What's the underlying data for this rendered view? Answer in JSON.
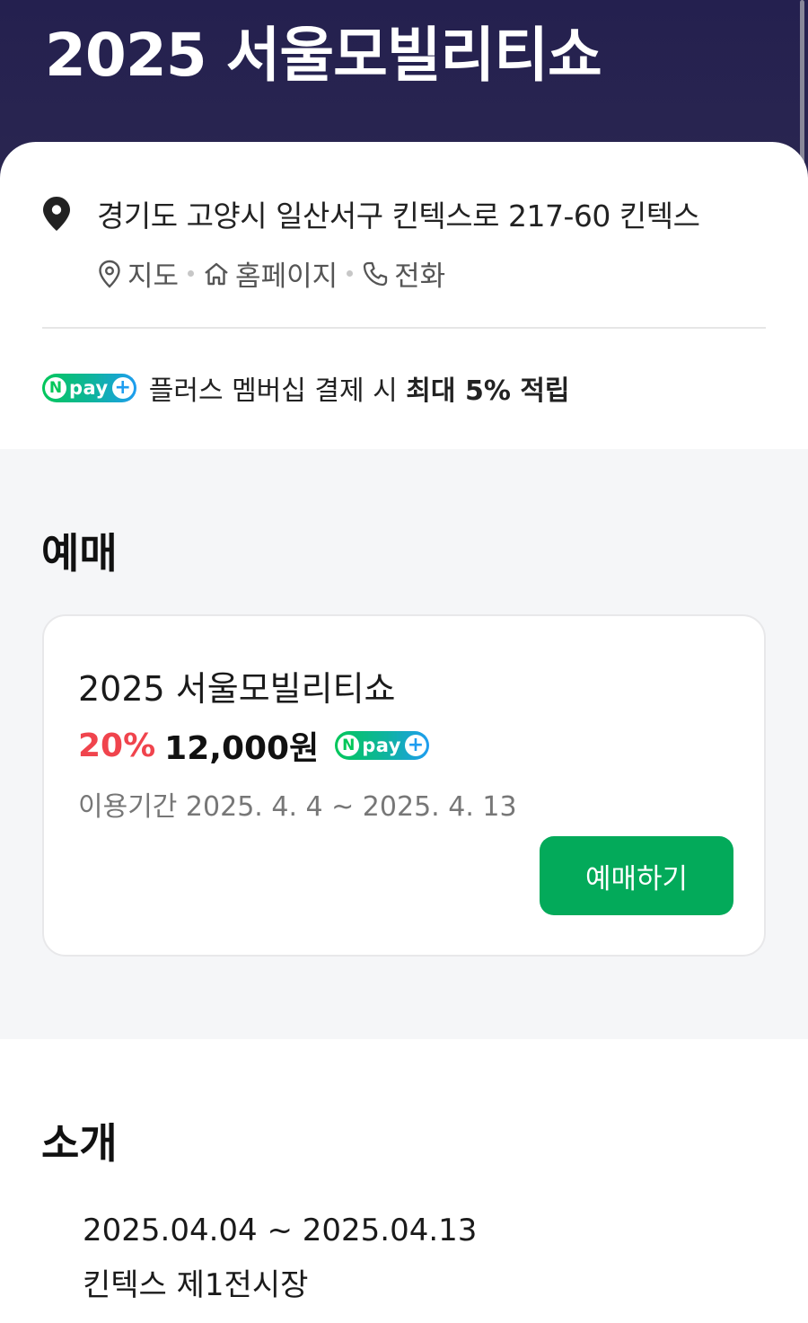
{
  "header": {
    "title": "2025 서울모빌리티쇼"
  },
  "info": {
    "address": "경기도 고양시 일산서구 킨텍스로 217-60 킨텍스",
    "links": [
      {
        "label": "지도",
        "icon": "map-pin-outline-icon"
      },
      {
        "label": "홈페이지",
        "icon": "home-icon"
      },
      {
        "label": "전화",
        "icon": "phone-icon"
      }
    ],
    "npay": {
      "badge_n": "N",
      "badge_word": "pay",
      "badge_plus": "+",
      "text_prefix": "플러스 멤버십 결제 시 ",
      "text_bold": "최대 5% 적립"
    }
  },
  "booking": {
    "title": "예매",
    "item": {
      "name": "2025 서울모빌리티쇼",
      "discount": "20%",
      "price": "12,000원",
      "period": "이용기간 2025. 4. 4 ~ 2025. 4. 13",
      "button_label": "예매하기"
    }
  },
  "intro": {
    "title": "소개",
    "dates": "2025.04.04 ~ 2025.04.13",
    "venue": "킨텍스 제1전시장"
  },
  "colors": {
    "header_bg": "#24204f",
    "accent_green": "#03aa5a",
    "discount_red": "#f0444d",
    "section_bg": "#f5f6f8"
  }
}
